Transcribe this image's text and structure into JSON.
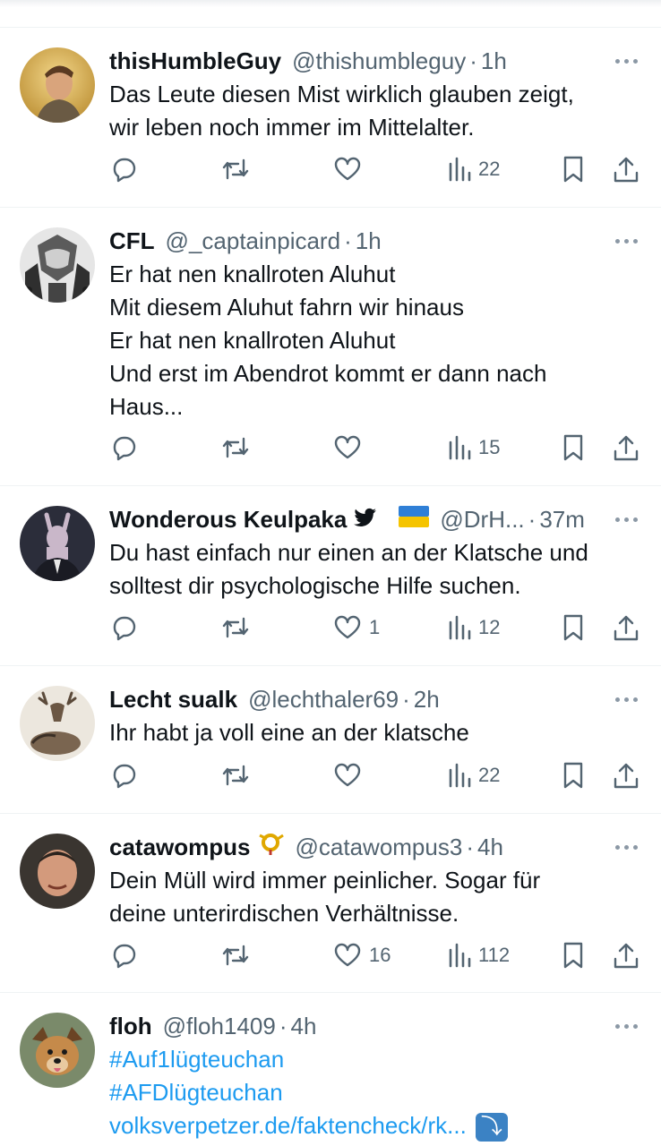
{
  "tweets": [
    {
      "name": "thisHumbleGuy",
      "handle": "@thishumbleguy",
      "time": "1h",
      "lines": [
        "Das Leute diesen Mist wirklich glauben zeigt,",
        "wir leben noch immer im Mittelalter."
      ],
      "likes": "",
      "views": "22"
    },
    {
      "name": "CFL",
      "handle": "@_captainpicard",
      "time": "1h",
      "lines": [
        "Er hat nen knallroten Aluhut",
        "Mit diesem Aluhut fahrn wir hinaus",
        "Er hat nen knallroten Aluhut",
        "Und erst im Abendrot kommt er dann nach",
        "Haus..."
      ],
      "likes": "",
      "views": "15"
    },
    {
      "name": "Wonderous Keulpaka",
      "handle": "@DrH...",
      "time": "37m",
      "lines": [
        "Du hast einfach nur einen an der Klatsche und",
        "solltest dir psychologische Hilfe suchen."
      ],
      "likes": "1",
      "views": "12"
    },
    {
      "name": "Lecht sualk",
      "handle": "@lechthaler69",
      "time": "2h",
      "lines": [
        "Ihr habt ja voll eine an der klatsche"
      ],
      "likes": "",
      "views": "22"
    },
    {
      "name": "catawompus",
      "handle": "@catawompus3",
      "time": "4h",
      "lines": [
        "Dein Müll wird immer peinlicher. Sogar für",
        "deine unterirdischen Verhältnisse."
      ],
      "likes": "16",
      "views": "112"
    },
    {
      "name": "floh",
      "handle": "@floh1409",
      "time": "4h",
      "lines": [
        "#Auf1lügteuchan",
        "#AFDlügteuchan",
        "volksverpetzer.de/faktencheck/rk..."
      ],
      "likes": "",
      "views": ""
    }
  ],
  "icons": {
    "reply": "reply-icon",
    "retweet": "retweet-icon",
    "like": "heart-icon",
    "views": "views-icon",
    "bookmark": "bookmark-icon",
    "share": "share-icon",
    "more": "more-icon"
  },
  "colors": {
    "text": "#0f1419",
    "muted": "#536471",
    "link": "#1d9bf0",
    "border": "#eff3f4"
  }
}
